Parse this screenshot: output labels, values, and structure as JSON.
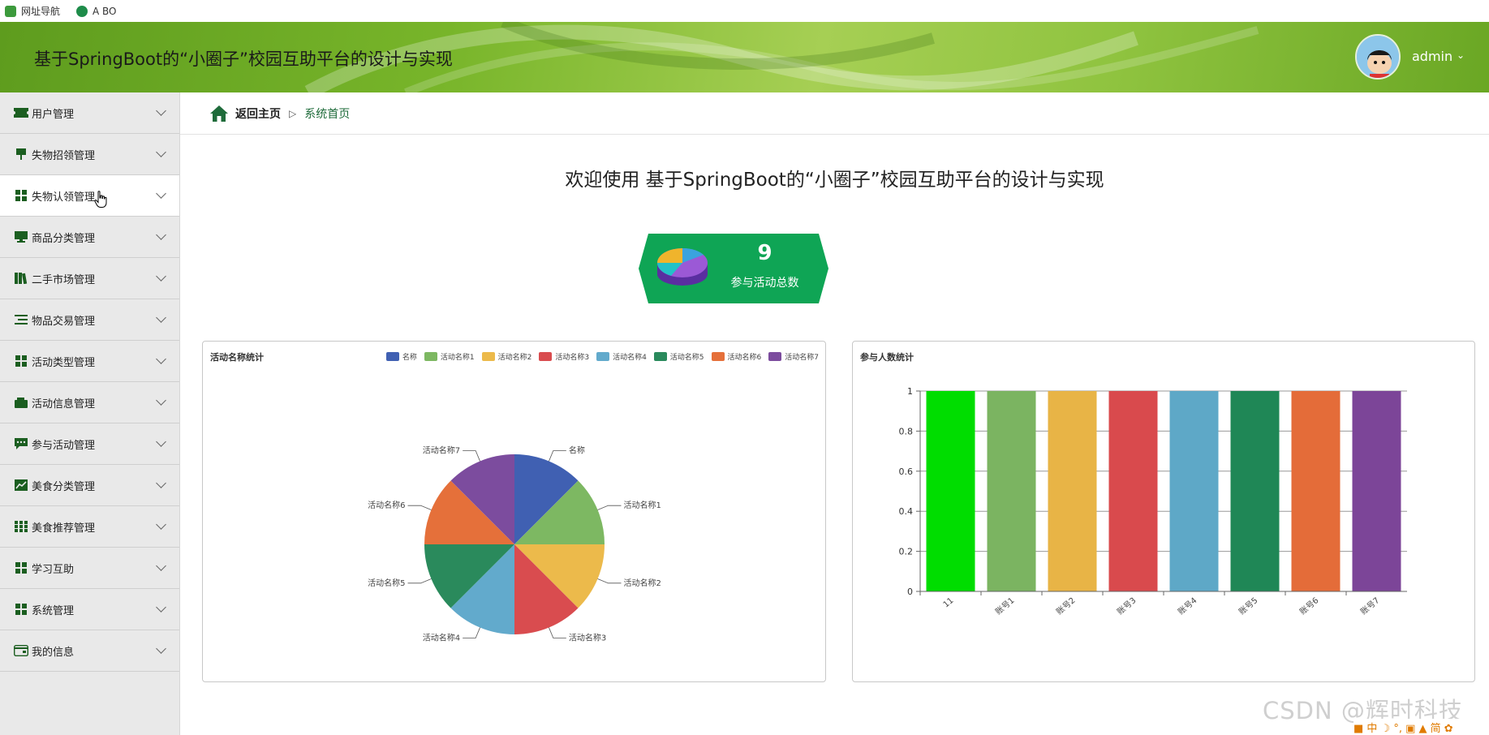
{
  "bookmarks": [
    {
      "label": "网址导航",
      "icon": "home-icon"
    },
    {
      "label": "A BO",
      "icon": "leaf-icon"
    }
  ],
  "header": {
    "title": "基于SpringBoot的“小圈子”校园互助平台的设计与实现",
    "user": "admin",
    "accent": "#78b52a"
  },
  "sidebar": {
    "items": [
      {
        "label": "用户管理",
        "icon": "ticket-icon"
      },
      {
        "label": "失物招领管理",
        "icon": "flag-icon"
      },
      {
        "label": "失物认领管理",
        "icon": "grid-icon"
      },
      {
        "label": "商品分类管理",
        "icon": "monitor-icon"
      },
      {
        "label": "二手市场管理",
        "icon": "books-icon"
      },
      {
        "label": "物品交易管理",
        "icon": "list-icon"
      },
      {
        "label": "活动类型管理",
        "icon": "grid-icon"
      },
      {
        "label": "活动信息管理",
        "icon": "wallet-icon"
      },
      {
        "label": "参与活动管理",
        "icon": "chat-icon"
      },
      {
        "label": "美食分类管理",
        "icon": "chart-icon"
      },
      {
        "label": "美食推荐管理",
        "icon": "table-icon"
      },
      {
        "label": "学习互助",
        "icon": "grid-icon"
      },
      {
        "label": "系统管理",
        "icon": "grid-icon"
      },
      {
        "label": "我的信息",
        "icon": "card-icon"
      }
    ]
  },
  "breadcrumb": {
    "home": "返回主页",
    "current": "系统首页"
  },
  "welcome": "欢迎使用 基于SpringBoot的“小圈子”校园互助平台的设计与实现",
  "stat": {
    "value": "9",
    "label": "参与活动总数",
    "color": "#0fa555"
  },
  "chart_data": [
    {
      "type": "pie",
      "title": "活动名称统计",
      "categories": [
        "名称",
        "活动名称1",
        "活动名称2",
        "活动名称3",
        "活动名称4",
        "活动名称5",
        "活动名称6",
        "活动名称7"
      ],
      "values": [
        1,
        1,
        1,
        1,
        1,
        1,
        1,
        1
      ],
      "colors": [
        "#4060b2",
        "#7db862",
        "#ecba4b",
        "#d94c4f",
        "#62aacc",
        "#2a8a5c",
        "#e5703a",
        "#7c4c9e"
      ],
      "legend": "top-right"
    },
    {
      "type": "bar",
      "title": "参与人数统计",
      "categories": [
        "11",
        "账号1",
        "账号2",
        "账号3",
        "账号4",
        "账号5",
        "账号6",
        "账号7"
      ],
      "values": [
        1,
        1,
        1,
        1,
        1,
        1,
        1,
        1
      ],
      "colors": [
        "#00dd00",
        "#7bb461",
        "#e8b446",
        "#d94a4d",
        "#5ea8c7",
        "#1f8756",
        "#e46c39",
        "#7c4598"
      ],
      "ylim": [
        0,
        1
      ],
      "yticks": [
        "0",
        "0.2",
        "0.4",
        "0.6",
        "0.8",
        "1"
      ],
      "grid": true
    }
  ],
  "watermark": "CSDN @辉时科技"
}
